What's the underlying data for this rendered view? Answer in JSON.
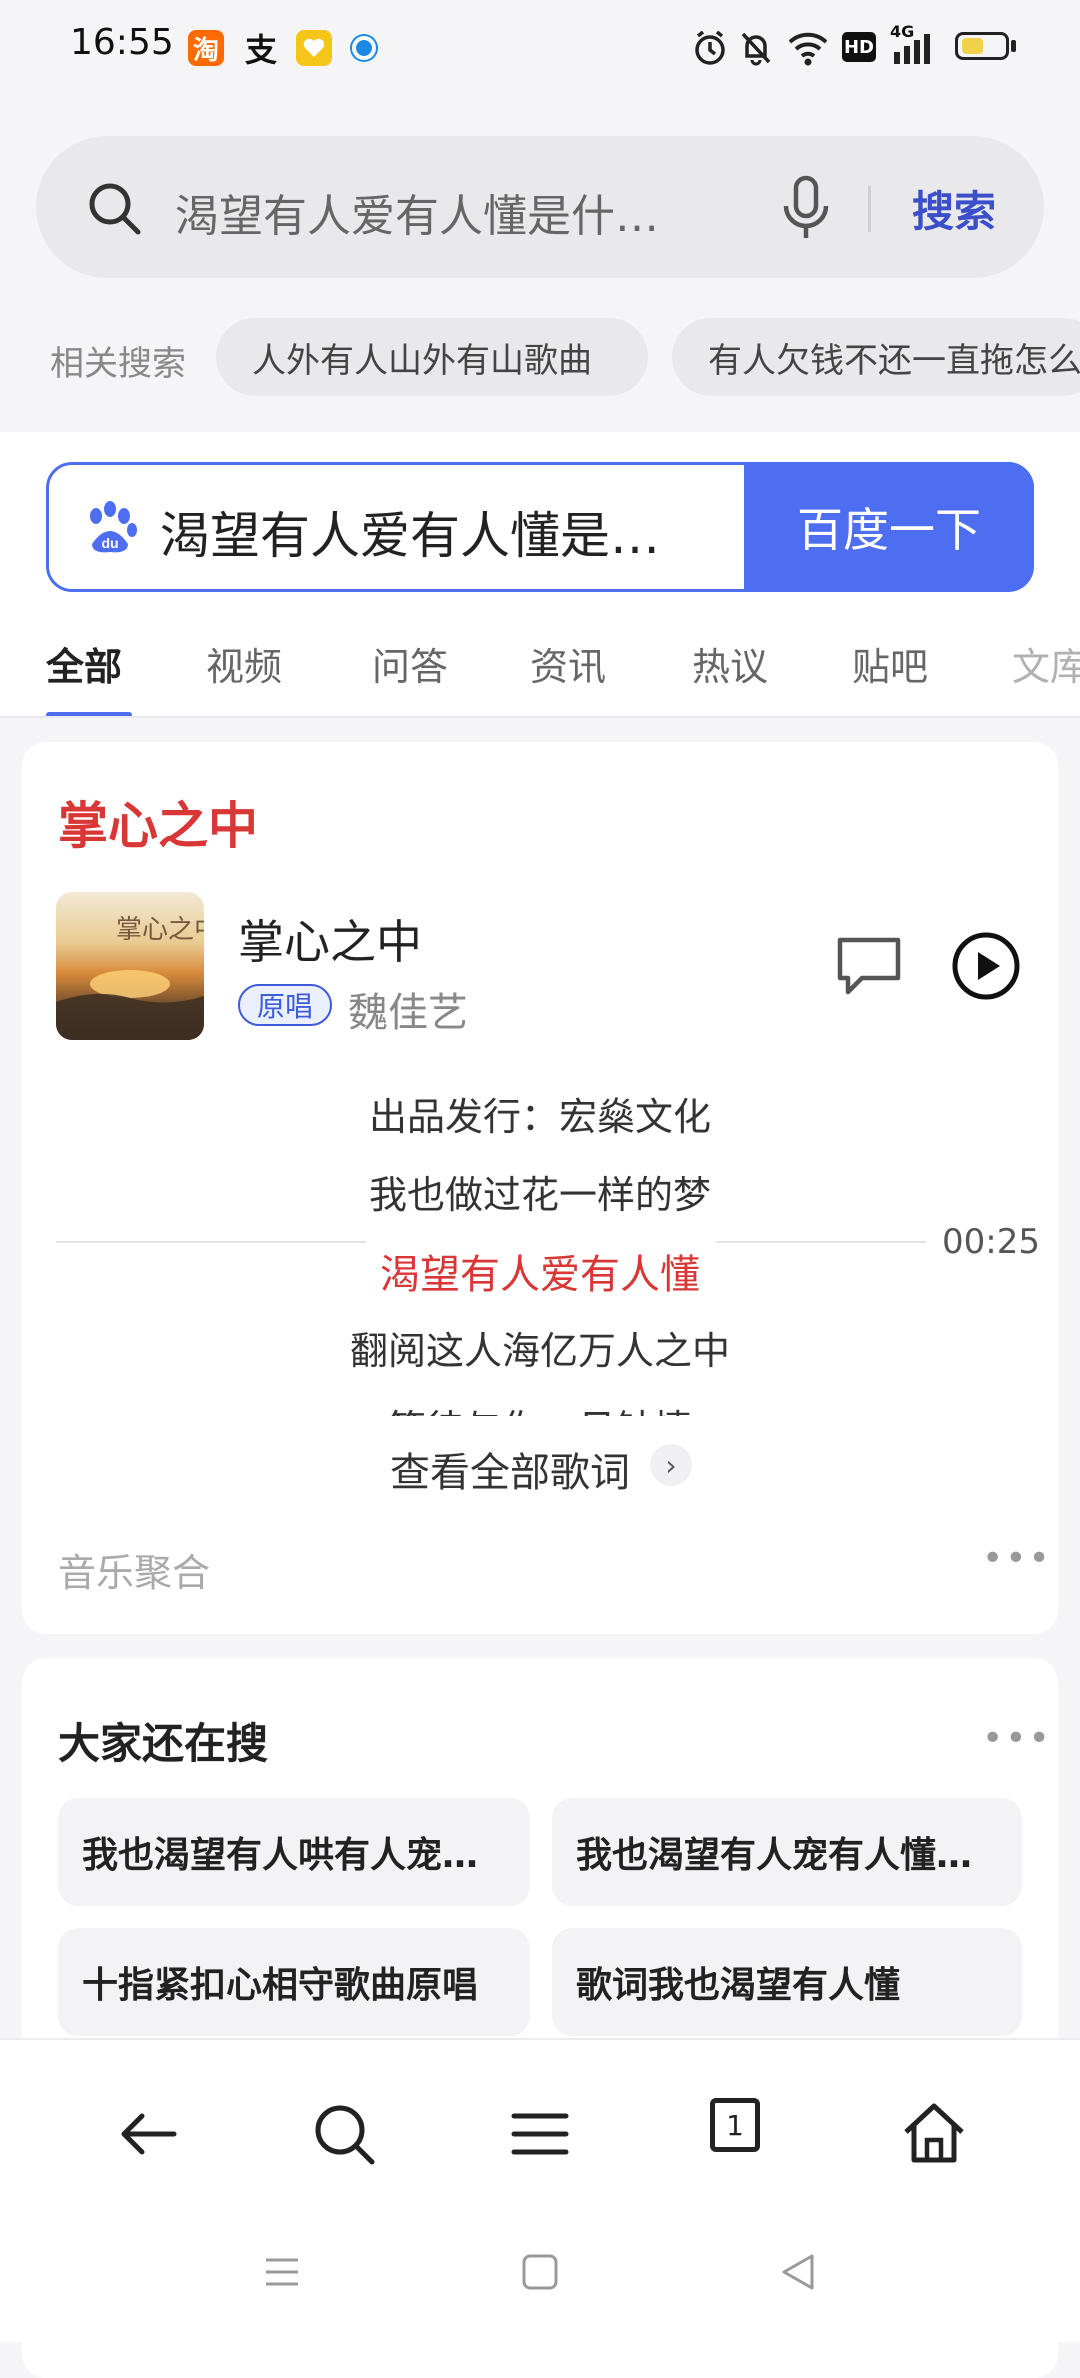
{
  "status_bar": {
    "time": "16:55",
    "app_icons": [
      "taobao-icon",
      "alipay-icon",
      "heart-icon",
      "dot-icon"
    ],
    "alipay_char": "支",
    "taobao_char": "淘",
    "network_label": "HD",
    "signal_label": "4G",
    "battery_level": 0.5
  },
  "search": {
    "query": "渴望有人爱有人懂是什…",
    "search_button": "搜索"
  },
  "related": {
    "label": "相关搜索",
    "chips": [
      "人外有人山外有山歌曲",
      "有人欠钱不还一直拖怎么"
    ]
  },
  "baidu": {
    "query": "渴望有人爱有人懂是…",
    "button": "百度一下"
  },
  "tabs": [
    "全部",
    "视频",
    "问答",
    "资讯",
    "热议",
    "贴吧",
    "文库"
  ],
  "active_tab": 0,
  "music_card": {
    "title": "掌心之中",
    "song_name": "掌心之中",
    "badge": "原唱",
    "singer": "魏佳艺",
    "lyrics": [
      "出品发行：宏燊文化",
      "我也做过花一样的梦",
      "渴望有人爱有人懂",
      "翻阅这人海亿万人之中",
      "等待与你一见钟情"
    ],
    "current_lyric_index": 2,
    "time": "00:25",
    "view_all": "查看全部歌词",
    "source": "音乐聚合",
    "accent_color": "#d93636"
  },
  "also_searched": {
    "title": "大家还在搜",
    "items": [
      "我也渴望有人哄有人宠…",
      "我也渴望有人宠有人懂…",
      "十指紧扣心相守歌曲原唱",
      "歌词我也渴望有人懂"
    ]
  },
  "nav": {
    "tab_count": "1",
    "icons": [
      "back-icon",
      "search-icon",
      "menu-icon",
      "tabs-icon",
      "home-icon"
    ]
  },
  "colors": {
    "brand_blue": "#4e6ef2",
    "search_blue": "#3a4fc9"
  }
}
